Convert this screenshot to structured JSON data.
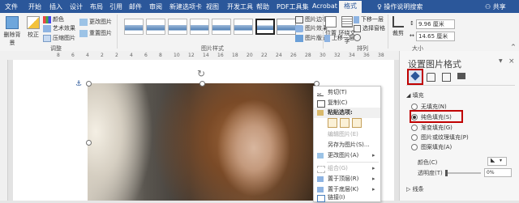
{
  "tabs": {
    "file": "文件",
    "home": "开始",
    "insert": "插入",
    "design": "设计",
    "layout": "布局",
    "references": "引用",
    "mailings": "邮件",
    "review": "审阅",
    "newtab": "新建选项卡",
    "view": "视图",
    "developer": "开发工具",
    "help": "帮助",
    "pdf": "PDF工具集",
    "acrobat": "Acrobat",
    "format": "格式",
    "tell_me": "操作说明搜索",
    "share": "共享"
  },
  "ribbon": {
    "remove_bg": "删除背景",
    "correct": "校正",
    "color": "颜色",
    "artistic": "艺术效果",
    "compress": "压缩图片",
    "change_pic": "更改图片",
    "reset_pic": "重置图片",
    "adjust_group": "调整",
    "styles_group": "图片样式",
    "border": "图片边框",
    "effects": "图片效果",
    "pic_layout": "图片版式",
    "position": "位置",
    "wrap": "环绕文字",
    "forward": "上移一层",
    "backward": "下移一层",
    "selection_pane": "选择窗格",
    "rotate": "",
    "arrange_group": "排列",
    "crop": "裁剪",
    "height": "9.96 厘米",
    "width": "14.65 厘米",
    "size_group": "大小"
  },
  "ruler_numbers": [
    "8",
    "6",
    "4",
    "2",
    "2",
    "4",
    "6",
    "8",
    "10",
    "12",
    "14",
    "16",
    "18",
    "20",
    "22",
    "24",
    "26",
    "28",
    "30",
    "32",
    "34",
    "36",
    "38"
  ],
  "context_menu": {
    "items": [
      {
        "label": "剪切(T)",
        "disabled": false
      },
      {
        "label": "复制(C)",
        "disabled": false
      },
      {
        "label": "粘贴选项:",
        "disabled": false,
        "header": true
      },
      {
        "label": "编辑图片(E)",
        "disabled": true
      },
      {
        "label": "另存为图片(S)...",
        "disabled": false
      },
      {
        "label": "更改图片(A)",
        "disabled": false,
        "submenu": true
      },
      {
        "label": "组合(G)",
        "disabled": true,
        "submenu": true
      },
      {
        "label": "置于顶层(R)",
        "disabled": false,
        "submenu": true
      },
      {
        "label": "置于底层(K)",
        "disabled": false,
        "submenu": true
      },
      {
        "label": "链接(I)",
        "disabled": false
      }
    ]
  },
  "pane": {
    "title": "设置图片格式",
    "close": "×",
    "fill_section": "◢ 填充",
    "options": [
      "无填充(N)",
      "纯色填充(S)",
      "渐变填充(G)",
      "图片或纹理填充(P)",
      "图案填充(A)"
    ],
    "selected_option": "纯色填充(S)",
    "color_label": "颜色(C)",
    "transparency_label": "透明度(T)",
    "transparency_value": "0%",
    "line_section": "▷ 线条"
  }
}
